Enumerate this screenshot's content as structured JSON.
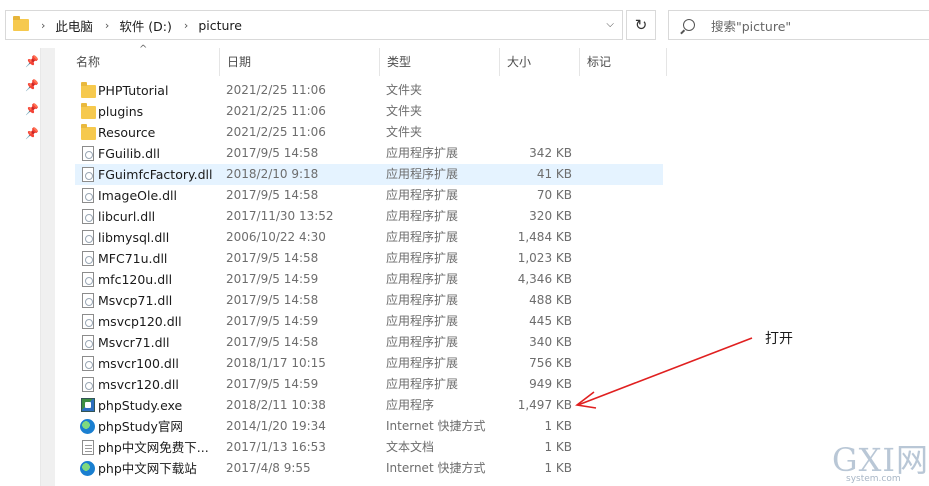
{
  "address": {
    "crumbs": [
      "此电脑",
      "软件 (D:)",
      "picture"
    ]
  },
  "search": {
    "placeholder": "搜索\"picture\""
  },
  "columns": {
    "name": "名称",
    "date": "日期",
    "type": "类型",
    "size": "大小",
    "tags": "标记"
  },
  "files": [
    {
      "name": "PHPTutorial",
      "date": "2021/2/25 11:06",
      "type": "文件夹",
      "size": "",
      "icon": "folder"
    },
    {
      "name": "plugins",
      "date": "2021/2/25 11:06",
      "type": "文件夹",
      "size": "",
      "icon": "folder"
    },
    {
      "name": "Resource",
      "date": "2021/2/25 11:06",
      "type": "文件夹",
      "size": "",
      "icon": "folder"
    },
    {
      "name": "FGuilib.dll",
      "date": "2017/9/5 14:58",
      "type": "应用程序扩展",
      "size": "342 KB",
      "icon": "dll"
    },
    {
      "name": "FGuimfcFactory.dll",
      "date": "2018/2/10 9:18",
      "type": "应用程序扩展",
      "size": "41 KB",
      "icon": "dll"
    },
    {
      "name": "ImageOle.dll",
      "date": "2017/9/5 14:58",
      "type": "应用程序扩展",
      "size": "70 KB",
      "icon": "dll"
    },
    {
      "name": "libcurl.dll",
      "date": "2017/11/30 13:52",
      "type": "应用程序扩展",
      "size": "320 KB",
      "icon": "dll"
    },
    {
      "name": "libmysql.dll",
      "date": "2006/10/22 4:30",
      "type": "应用程序扩展",
      "size": "1,484 KB",
      "icon": "dll"
    },
    {
      "name": "MFC71u.dll",
      "date": "2017/9/5 14:58",
      "type": "应用程序扩展",
      "size": "1,023 KB",
      "icon": "dll"
    },
    {
      "name": "mfc120u.dll",
      "date": "2017/9/5 14:59",
      "type": "应用程序扩展",
      "size": "4,346 KB",
      "icon": "dll"
    },
    {
      "name": "Msvcp71.dll",
      "date": "2017/9/5 14:58",
      "type": "应用程序扩展",
      "size": "488 KB",
      "icon": "dll"
    },
    {
      "name": "msvcp120.dll",
      "date": "2017/9/5 14:59",
      "type": "应用程序扩展",
      "size": "445 KB",
      "icon": "dll"
    },
    {
      "name": "Msvcr71.dll",
      "date": "2017/9/5 14:58",
      "type": "应用程序扩展",
      "size": "340 KB",
      "icon": "dll"
    },
    {
      "name": "msvcr100.dll",
      "date": "2018/1/17 10:15",
      "type": "应用程序扩展",
      "size": "756 KB",
      "icon": "dll"
    },
    {
      "name": "msvcr120.dll",
      "date": "2017/9/5 14:59",
      "type": "应用程序扩展",
      "size": "949 KB",
      "icon": "dll"
    },
    {
      "name": "phpStudy.exe",
      "date": "2018/2/11 10:38",
      "type": "应用程序",
      "size": "1,497 KB",
      "icon": "exe"
    },
    {
      "name": "phpStudy官网",
      "date": "2014/1/20 19:34",
      "type": "Internet 快捷方式",
      "size": "1 KB",
      "icon": "web"
    },
    {
      "name": "php中文网免费下...",
      "date": "2017/1/13 16:53",
      "type": "文本文档",
      "size": "1 KB",
      "icon": "txt"
    },
    {
      "name": "php中文网下载站",
      "date": "2017/4/8 9:55",
      "type": "Internet 快捷方式",
      "size": "1 KB",
      "icon": "web"
    }
  ],
  "selected_index": 4,
  "annotation": {
    "text": "打开",
    "color": "#e02020"
  },
  "watermark": {
    "main": "GXI网",
    "sub": "system.com"
  }
}
